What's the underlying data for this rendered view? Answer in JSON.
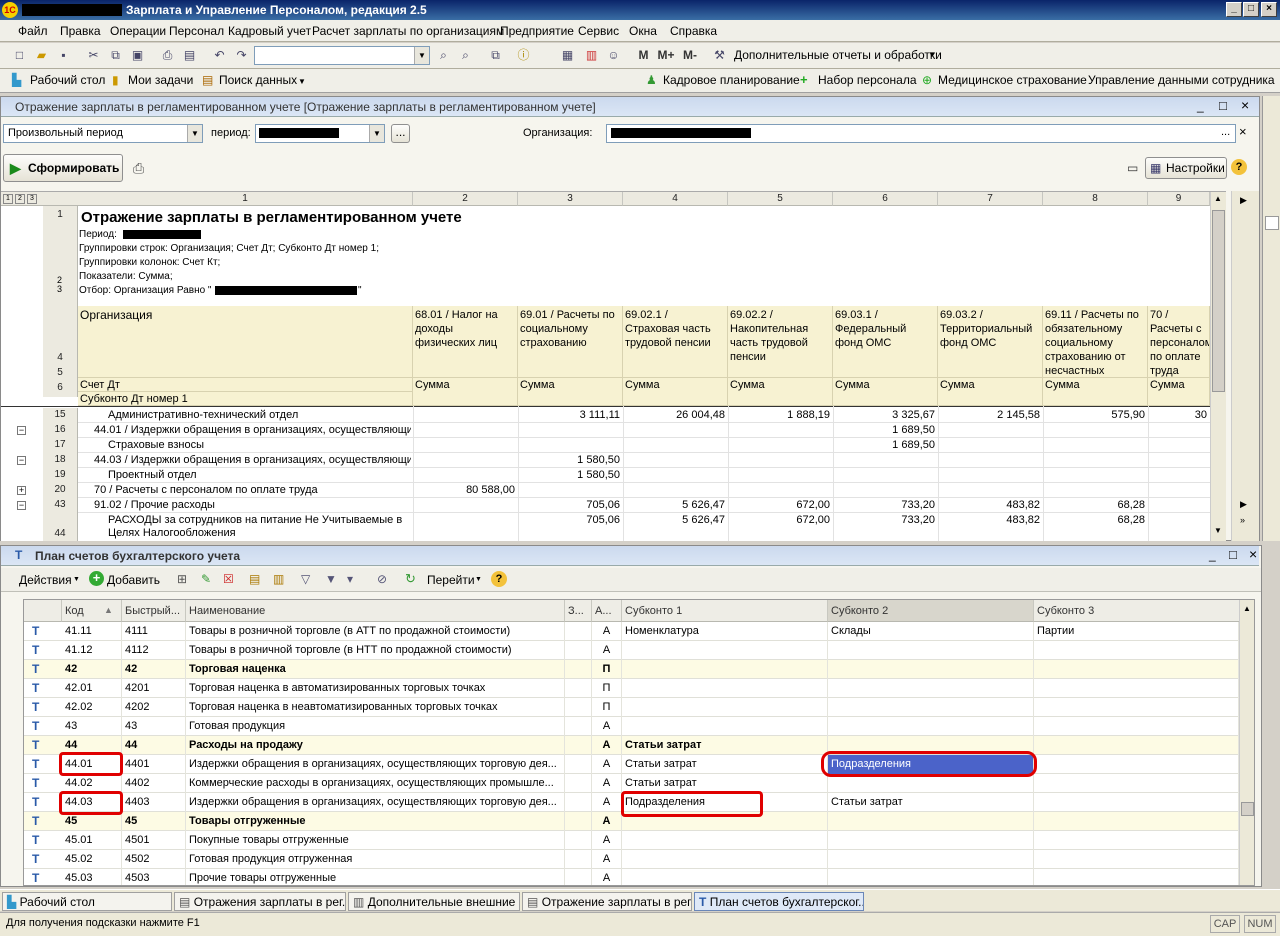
{
  "window": {
    "logo": "1С",
    "title": "Зарплата и Управление Персоналом, редакция 2.5",
    "min": "_",
    "max": "□",
    "close": "×"
  },
  "menu": [
    "Файл",
    "Правка",
    "Операции",
    "Персонал",
    "Кадровый учет",
    "Расчет зарплаты по организациям",
    "Предприятие",
    "Сервис",
    "Окна",
    "Справка"
  ],
  "toolbar": {
    "extra_reports": "Дополнительные отчеты и обработки",
    "m1": "M",
    "m2": "M+",
    "m3": "M-"
  },
  "quickbar": {
    "left": [
      "Рабочий стол",
      "Мои задачи",
      "Поиск данных"
    ],
    "right": [
      "Кадровое планирование",
      "Набор персонала",
      "Медицинское страхование",
      "Управление данными сотрудника"
    ]
  },
  "report": {
    "window_title": "Отражение зарплаты в регламентированном учете [Отражение зарплаты в регламентированном учете]",
    "period_type": "Произвольный период",
    "period_label": "период:",
    "org_label": "Организация:",
    "ellipsis": "...",
    "form_button": "Сформировать",
    "settings_button": "Настройки",
    "outline_levels": [
      "1",
      "2",
      "3"
    ],
    "col_numbers": [
      "1",
      "2",
      "3",
      "4",
      "5",
      "6",
      "7",
      "8",
      "9"
    ],
    "heading": "Отражение зарплаты в регламентированном учете",
    "meta": {
      "period": "Период:",
      "rows": "Группировки строк: Организация; Счет Дт; Субконто Дт номер 1;",
      "cols": "Группировки колонок: Счет Кт;",
      "indicators": "Показатели: Сумма;",
      "filter": "Отбор: Организация Равно \"",
      "filter_end": "\""
    },
    "header_left": {
      "org": "Организация",
      "acct": "Счет Дт",
      "sub": "Субконто Дт номер 1"
    },
    "header_cols": [
      "68.01 / Налог на доходы физических лиц",
      "69.01 / Расчеты по социальному страхованию",
      "69.02.1 / Страховая часть трудовой пенсии",
      "69.02.2 / Накопительная часть трудовой пенсии",
      "69.03.1 / Федеральный фонд ОМС",
      "69.03.2 / Территориальный фонд ОМС",
      "69.11 / Расчеты по обязательному социальному страхованию от несчастных",
      "70 / Расчеты с персоналом по оплате труда"
    ],
    "sum_label": "Сумма",
    "header_rows": [
      "1",
      "2",
      "3",
      "4",
      "5",
      "6"
    ],
    "rows": [
      {
        "n": "15",
        "label": "Административно-технический отдел",
        "v": [
          "",
          "3 111,11",
          "26 004,48",
          "1 888,19",
          "3 325,67",
          "2 145,58",
          "575,90",
          "30"
        ]
      },
      {
        "n": "16",
        "label": "44.01 / Издержки обращения в организациях, осуществляющи",
        "v": [
          "",
          "",
          "",
          "",
          "1 689,50",
          "",
          "",
          ""
        ]
      },
      {
        "n": "17",
        "label": "Страховые взносы",
        "v": [
          "",
          "",
          "",
          "",
          "1 689,50",
          "",
          "",
          ""
        ]
      },
      {
        "n": "18",
        "label": "44.03 / Издержки обращения в организациях, осуществляющи",
        "v": [
          "",
          "1 580,50",
          "",
          "",
          "",
          "",
          "",
          ""
        ]
      },
      {
        "n": "19",
        "label": "Проектный отдел",
        "v": [
          "",
          "1 580,50",
          "",
          "",
          "",
          "",
          "",
          ""
        ]
      },
      {
        "n": "20",
        "label": "70 / Расчеты с персоналом по оплате труда",
        "v": [
          "80 588,00",
          "",
          "",
          "",
          "",
          "",
          "",
          ""
        ]
      },
      {
        "n": "43",
        "label": "91.02 / Прочие расходы",
        "v": [
          "",
          "705,06",
          "5 626,47",
          "672,00",
          "733,20",
          "483,82",
          "68,28",
          ""
        ]
      },
      {
        "n": "44",
        "label": "РАСХОДЫ за сотрудников на питание Не Учитываемые в Целях Налогообложения",
        "v": [
          "",
          "705,06",
          "5 626,47",
          "672,00",
          "733,20",
          "483,82",
          "68,28",
          ""
        ]
      }
    ]
  },
  "chart_of_accounts": {
    "window_title": "План счетов бухгалтерского учета",
    "actions": "Действия",
    "add": "Добавить",
    "goto": "Перейти",
    "columns": [
      "Код",
      "Быстрый...",
      "Наименование",
      "З...",
      "А...",
      "Субконто 1",
      "Субконто 2",
      "Субконто 3"
    ],
    "rows": [
      {
        "code": "41.11",
        "fast": "4111",
        "name": "Товары в розничной торговле (в АТТ по продажной стоимости)",
        "z": "",
        "a": "А",
        "s1": "Номенклатура",
        "s2": "Склады",
        "s3": "Партии",
        "bold": false
      },
      {
        "code": "41.12",
        "fast": "4112",
        "name": "Товары в розничной торговле (в НТТ по продажной стоимости)",
        "z": "",
        "a": "А",
        "s1": "",
        "s2": "",
        "s3": "",
        "bold": false
      },
      {
        "code": "42",
        "fast": "42",
        "name": "Торговая наценка",
        "z": "",
        "a": "П",
        "s1": "",
        "s2": "",
        "s3": "",
        "bold": true
      },
      {
        "code": "42.01",
        "fast": "4201",
        "name": "Торговая наценка в автоматизированных торговых точках",
        "z": "",
        "a": "П",
        "s1": "",
        "s2": "",
        "s3": "",
        "bold": false
      },
      {
        "code": "42.02",
        "fast": "4202",
        "name": "Торговая наценка в неавтоматизированных торговых точках",
        "z": "",
        "a": "П",
        "s1": "",
        "s2": "",
        "s3": "",
        "bold": false
      },
      {
        "code": "43",
        "fast": "43",
        "name": "Готовая продукция",
        "z": "",
        "a": "А",
        "s1": "",
        "s2": "",
        "s3": "",
        "bold": false
      },
      {
        "code": "44",
        "fast": "44",
        "name": "Расходы на продажу",
        "z": "",
        "a": "А",
        "s1": "Статьи затрат",
        "s2": "",
        "s3": "",
        "bold": true
      },
      {
        "code": "44.01",
        "fast": "4401",
        "name": "Издержки обращения в организациях, осуществляющих торговую дея...",
        "z": "",
        "a": "А",
        "s1": "Статьи затрат",
        "s2": "Подразделения",
        "s3": "",
        "bold": false
      },
      {
        "code": "44.02",
        "fast": "4402",
        "name": "Коммерческие расходы в организациях, осуществляющих промышле...",
        "z": "",
        "a": "А",
        "s1": "Статьи затрат",
        "s2": "",
        "s3": "",
        "bold": false
      },
      {
        "code": "44.03",
        "fast": "4403",
        "name": "Издержки обращения в организациях, осуществляющих торговую дея...",
        "z": "",
        "a": "А",
        "s1": "Подразделения",
        "s2": "Статьи затрат",
        "s3": "",
        "bold": false
      },
      {
        "code": "45",
        "fast": "45",
        "name": "Товары отгруженные",
        "z": "",
        "a": "А",
        "s1": "",
        "s2": "",
        "s3": "",
        "bold": true
      },
      {
        "code": "45.01",
        "fast": "4501",
        "name": "Покупные товары отгруженные",
        "z": "",
        "a": "А",
        "s1": "",
        "s2": "",
        "s3": "",
        "bold": false
      },
      {
        "code": "45.02",
        "fast": "4502",
        "name": "Готовая продукция отгруженная",
        "z": "",
        "a": "А",
        "s1": "",
        "s2": "",
        "s3": "",
        "bold": false
      },
      {
        "code": "45.03",
        "fast": "4503",
        "name": "Прочие товары отгруженные",
        "z": "",
        "a": "А",
        "s1": "",
        "s2": "",
        "s3": "",
        "bold": false
      }
    ]
  },
  "taskbar": [
    "Рабочий стол",
    "Отражения зарплаты в рег...",
    "Дополнительные внешние ...",
    "Отражение зарплаты в рег...",
    "План счетов бухгалтерског..."
  ],
  "status": {
    "hint": "Для получения подсказки нажмите F1",
    "cap": "CAP",
    "num": "NUM"
  }
}
